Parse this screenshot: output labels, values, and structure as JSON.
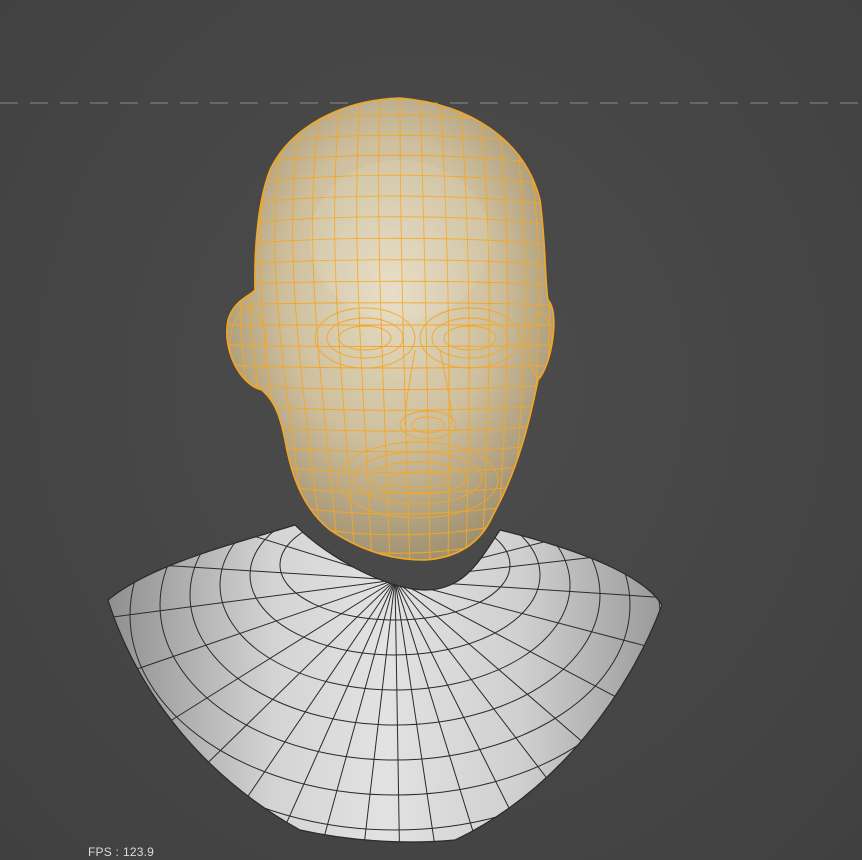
{
  "viewport": {
    "fps_label": "FPS :",
    "fps_value": "123.9"
  },
  "colors": {
    "background": "#474747",
    "selection_wire": "#f5a623",
    "head_fill": "#d9cdb0",
    "body_fill": "#c9c9c9",
    "body_wire": "#2a2a2a",
    "grid_line": "#8a8a8a"
  },
  "scene": {
    "selected_object": "head",
    "unselected_object": "shoulders"
  }
}
